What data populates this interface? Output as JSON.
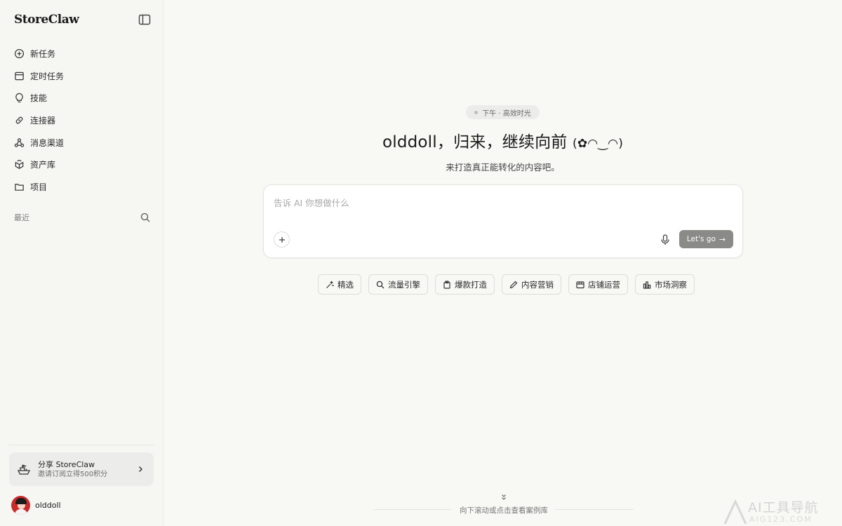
{
  "sidebar": {
    "brand": "StoreClaw",
    "items": [
      {
        "label": "新任务",
        "icon": "plus-circle-icon"
      },
      {
        "label": "定时任务",
        "icon": "calendar-icon"
      },
      {
        "label": "技能",
        "icon": "lightbulb-icon"
      },
      {
        "label": "连接器",
        "icon": "link-icon"
      },
      {
        "label": "消息渠道",
        "icon": "share-nodes-icon"
      },
      {
        "label": "资产库",
        "icon": "box-icon"
      },
      {
        "label": "项目",
        "icon": "folder-icon"
      }
    ],
    "recent_label": "最近",
    "share": {
      "title": "分享 StoreClaw",
      "subtitle": "邀请订阅立得500积分"
    },
    "user": {
      "name": "olddoll"
    }
  },
  "main": {
    "time_badge": "下午 · 高效时光",
    "greeting": "olddoll，归来，继续向前",
    "greeting_emoticon": "(✿◠‿◠)",
    "subtitle": "来打造真正能转化的内容吧。",
    "prompt": {
      "placeholder": "告诉 AI 你想做什么",
      "value": "",
      "submit_label": "Let's go",
      "submit_arrow": "→"
    },
    "chips": [
      {
        "label": "精选",
        "icon": "sparkle-wand-icon"
      },
      {
        "label": "流量引擎",
        "icon": "search-icon"
      },
      {
        "label": "爆款打造",
        "icon": "clipboard-icon"
      },
      {
        "label": "内容营销",
        "icon": "pencil-icon"
      },
      {
        "label": "店铺运营",
        "icon": "store-icon"
      },
      {
        "label": "市场洞察",
        "icon": "bar-chart-icon"
      }
    ],
    "scroll_hint": "向下滚动或点击查看案例库"
  },
  "watermark": {
    "text": "AI工具导航",
    "sub": "AIG123.COM"
  },
  "colors": {
    "background": "#f8f8f5",
    "sidebar": "#f6f6f3",
    "submit_button": "#8a8a87",
    "avatar": "#c92a2a"
  }
}
